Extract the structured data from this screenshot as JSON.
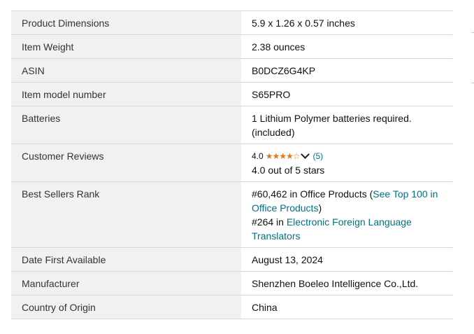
{
  "product_details": {
    "rows": [
      {
        "label": "Product Dimensions",
        "value": "5.9 x 1.26 x 0.57 inches"
      },
      {
        "label": "Item Weight",
        "value": "2.38 ounces"
      },
      {
        "label": "ASIN",
        "value": "B0DCZ6G4KP"
      },
      {
        "label": "Item model number",
        "value": "S65PRO"
      },
      {
        "label": "Batteries",
        "value_line1": "1 Lithium Polymer batteries required.",
        "value_line2": "(included)"
      },
      {
        "label": "Customer Reviews",
        "rating_value": "4.0",
        "rating_fraction": 0.8,
        "stars_icon": "star-rating-icon",
        "rating_count": "(5)",
        "rating_text": "4.0 out of 5 stars"
      },
      {
        "label": "Best Sellers Rank",
        "rank1_prefix": "#60,462 in Office Products (",
        "rank1_link": "See Top 100 in Office Products",
        "rank1_suffix": ")",
        "rank2_prefix": "#264 in ",
        "rank2_link": "Electronic Foreign Language Translators"
      },
      {
        "label": "Date First Available",
        "value": "August 13, 2024"
      },
      {
        "label": "Manufacturer",
        "value": "Shenzhen Boeleo Intelligence Co.,Ltd."
      },
      {
        "label": "Country of Origin",
        "value": "China"
      }
    ]
  },
  "colors": {
    "label_bg": "#f0f2f2",
    "border": "#d5d9d9",
    "link": "#007185",
    "star": "#de7921"
  }
}
